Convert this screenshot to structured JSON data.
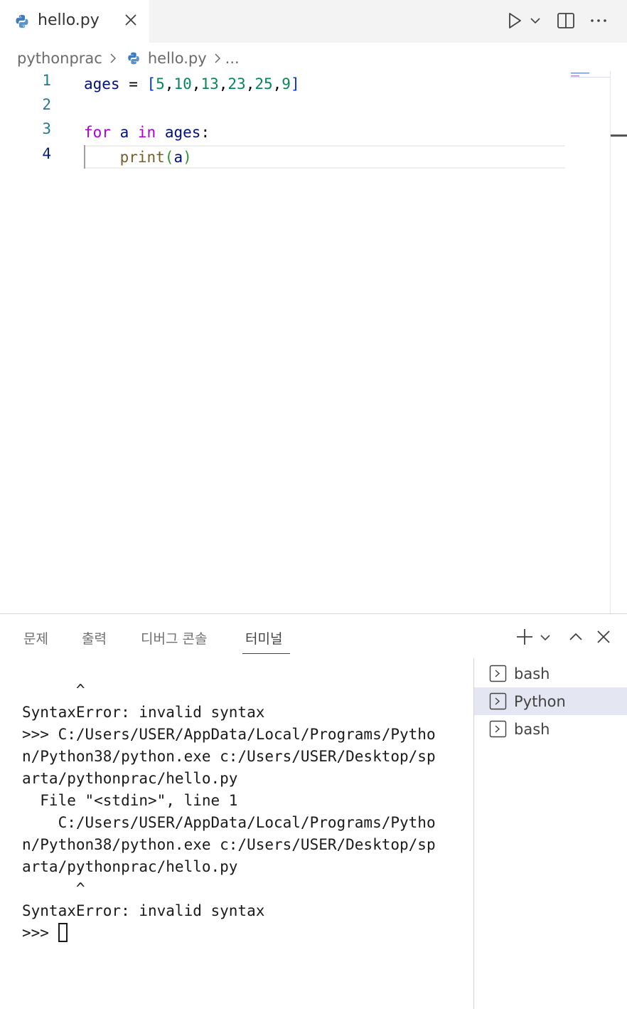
{
  "tab": {
    "filename": "hello.py"
  },
  "breadcrumb": {
    "folder": "pythonprac",
    "file": "hello.py",
    "more": "..."
  },
  "editor": {
    "line_numbers": [
      "1",
      "2",
      "3",
      "4"
    ],
    "lines": [
      [
        {
          "t": "ages",
          "c": "var"
        },
        {
          "t": " = ",
          "c": "op"
        },
        {
          "t": "[",
          "c": "br"
        },
        {
          "t": "5",
          "c": "num"
        },
        {
          "t": ",",
          "c": "op"
        },
        {
          "t": "10",
          "c": "num"
        },
        {
          "t": ",",
          "c": "op"
        },
        {
          "t": "13",
          "c": "num"
        },
        {
          "t": ",",
          "c": "op"
        },
        {
          "t": "23",
          "c": "num"
        },
        {
          "t": ",",
          "c": "op"
        },
        {
          "t": "25",
          "c": "num"
        },
        {
          "t": ",",
          "c": "op"
        },
        {
          "t": "9",
          "c": "num"
        },
        {
          "t": "]",
          "c": "br"
        }
      ],
      [],
      [
        {
          "t": "for",
          "c": "kw"
        },
        {
          "t": " ",
          "c": "op"
        },
        {
          "t": "a",
          "c": "var"
        },
        {
          "t": " ",
          "c": "op"
        },
        {
          "t": "in",
          "c": "kw"
        },
        {
          "t": " ",
          "c": "op"
        },
        {
          "t": "ages",
          "c": "var"
        },
        {
          "t": ":",
          "c": "op"
        }
      ],
      [
        {
          "t": "    ",
          "c": "op"
        },
        {
          "t": "print",
          "c": "fn"
        },
        {
          "t": "(",
          "c": "br2"
        },
        {
          "t": "a",
          "c": "var"
        },
        {
          "t": ")",
          "c": "br2"
        }
      ]
    ]
  },
  "panel": {
    "tabs": [
      "문제",
      "출력",
      "디버그 콘솔",
      "터미널"
    ],
    "active_tab": "터미널"
  },
  "terminal": {
    "lines": [
      "      ^",
      "SyntaxError: invalid syntax",
      ">>> C:/Users/USER/AppData/Local/Programs/Pytho",
      "n/Python38/python.exe c:/Users/USER/Desktop/sp",
      "arta/pythonprac/hello.py",
      "  File \"<stdin>\", line 1",
      "    C:/Users/USER/AppData/Local/Programs/Pytho",
      "n/Python38/python.exe c:/Users/USER/Desktop/sp",
      "arta/pythonprac/hello.py",
      "      ^",
      "SyntaxError: invalid syntax"
    ],
    "prompt": ">>> ",
    "instances": [
      "bash",
      "Python",
      "bash"
    ],
    "active_instance": "Python"
  },
  "colors": {
    "accent": "#0b216f",
    "line_number": "#237893",
    "keyword": "#af00db",
    "number": "#098658",
    "function": "#795e26",
    "selection": "#e4e6f1"
  },
  "icons": {
    "tab_file": "python-icon",
    "tab_close": "close-icon",
    "run": "play-icon",
    "run_menu": "chevron-down-icon",
    "split": "split-editor-icon",
    "more": "more-icon",
    "new_terminal": "plus-icon",
    "maximize": "chevron-up-icon",
    "close_panel": "close-icon",
    "terminal_item": "terminal-icon"
  }
}
